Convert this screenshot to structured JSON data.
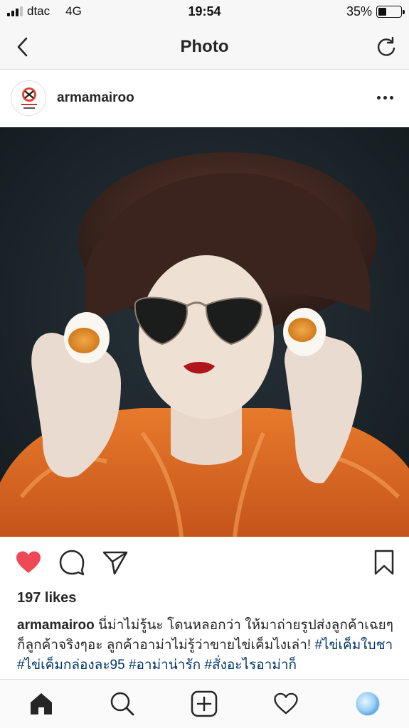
{
  "status_bar": {
    "carrier": "dtac",
    "network": "4G",
    "time": "19:54",
    "battery_percent_label": "35%",
    "battery_level": 0.35,
    "signal_bars_active": 3,
    "signal_bars_total": 4
  },
  "nav": {
    "title": "Photo",
    "back_icon": "chevron-left-icon",
    "refresh_icon": "refresh-icon"
  },
  "post": {
    "username": "armamairoo",
    "avatar_icon": "profile-avatar-logo",
    "more_icon": "more-horizontal-icon",
    "likes_text": "197 likes",
    "liked": true,
    "caption_user": "armamairoo",
    "caption_text": " นี่ม่าไม่รู้นะ โดนหลอกว่า ให้มาถ่ายรูปส่งลูกค้าเฉยๆ ก็ลูกค้าจริงๆอะ ลูกค้าอาม่าไม่รู้ว่าขายไข่เค็มไงเล่า! ",
    "hashtags": [
      "#ไข่เค็มใบชา",
      "#ไข่เค็มกล่องละ95",
      "#อาม่าน่ารัก",
      "#สั่งอะไรอาม่าก็"
    ]
  },
  "actions": {
    "like_icon": "heart-filled-icon",
    "comment_icon": "comment-icon",
    "share_icon": "send-icon",
    "save_icon": "bookmark-icon"
  },
  "tab_bar": {
    "items": [
      "home-icon",
      "search-icon",
      "add-post-icon",
      "activity-heart-icon",
      "profile-avatar"
    ]
  },
  "colors": {
    "like_red": "#ed4956",
    "hashtag_blue": "#003569",
    "text": "#262626",
    "bar_bg": "#f7f7f7"
  }
}
